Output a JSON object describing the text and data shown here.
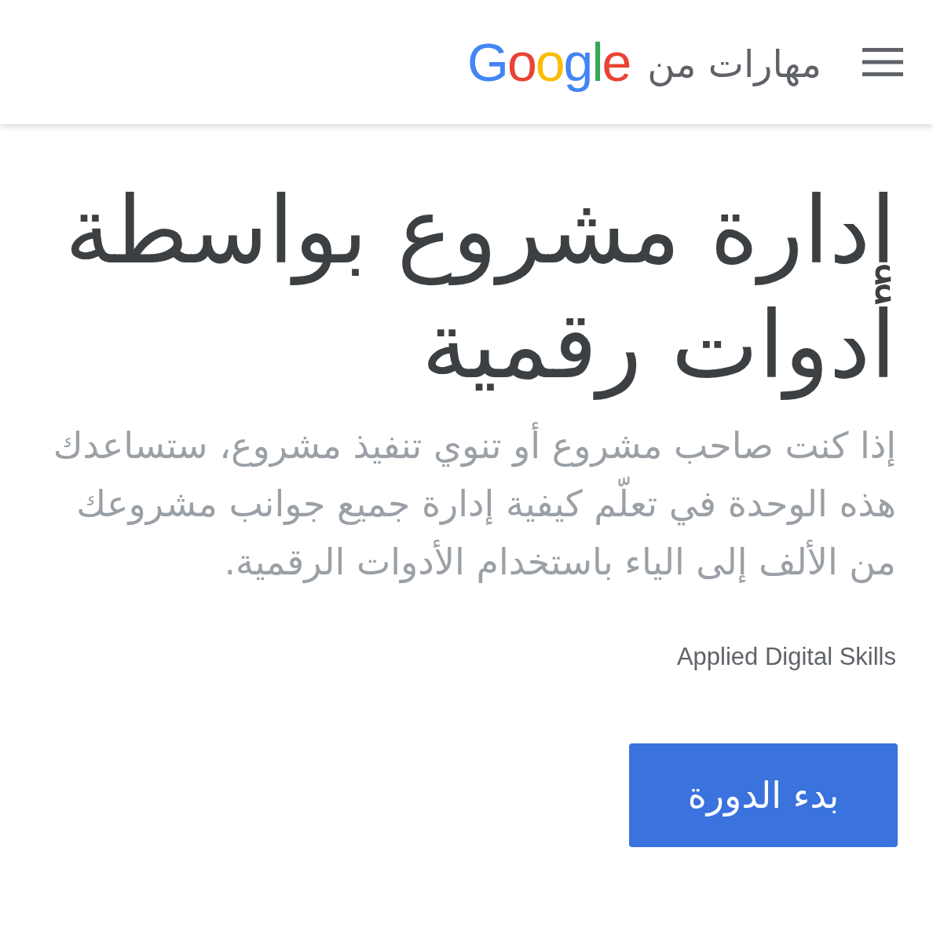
{
  "header": {
    "brand_text": "مهارات من",
    "logo": "Google"
  },
  "course": {
    "title": "إدارة مشروع بواسطة أدوات رقمية",
    "description": "إذا كنت صاحب مشروع أو تنوي تنفيذ مشروع، ستساعدك هذه الوحدة في تعلّم كيفية إدارة جميع جوانب مشروعك من الألف إلى الياء باستخدام الأدوات الرقمية.",
    "provider": "Applied Digital Skills",
    "start_button": "بدء الدورة"
  }
}
